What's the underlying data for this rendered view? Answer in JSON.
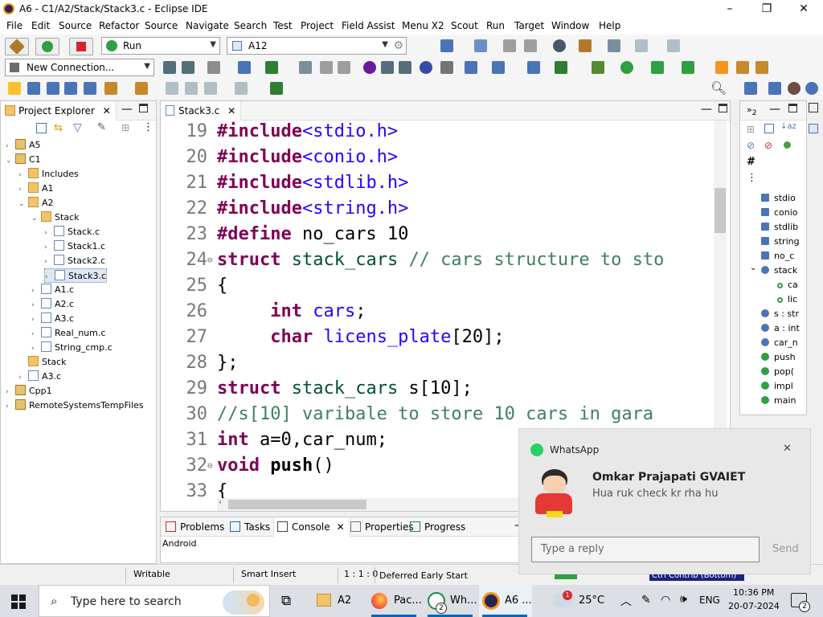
{
  "window": {
    "title": "A6 - C1/A2/Stack/Stack3.c - Eclipse IDE",
    "minimize": "–",
    "maximize": "❐",
    "close": "✕"
  },
  "menu": [
    "File",
    "Edit",
    "Source",
    "Refactor",
    "Source",
    "Navigate",
    "Search",
    "Test",
    "Project",
    "Field Assist",
    "Menu X2",
    "Scout",
    "Run",
    "Target",
    "Window",
    "Help"
  ],
  "toolbar": {
    "run_combo": "Run",
    "target_combo": "A12",
    "connection_combo": "New Connection..."
  },
  "project_explorer": {
    "tab_label": "Project Explorer",
    "items": [
      {
        "label": "A5",
        "kind": "proj",
        "depth": 0,
        "tw": "›"
      },
      {
        "label": "C1",
        "kind": "proj",
        "depth": 0,
        "tw": "⌄"
      },
      {
        "label": "Includes",
        "kind": "inc",
        "depth": 1,
        "tw": "›"
      },
      {
        "label": "A1",
        "kind": "folder",
        "depth": 1,
        "tw": "›"
      },
      {
        "label": "A2",
        "kind": "folder",
        "depth": 1,
        "tw": "⌄"
      },
      {
        "label": "Stack",
        "kind": "folder",
        "depth": 2,
        "tw": "⌄"
      },
      {
        "label": "Stack.c",
        "kind": "cfile",
        "depth": 3,
        "tw": "›"
      },
      {
        "label": "Stack1.c",
        "kind": "cfile",
        "depth": 3,
        "tw": "›"
      },
      {
        "label": "Stack2.c",
        "kind": "cfile",
        "depth": 3,
        "tw": "›"
      },
      {
        "label": "Stack3.c",
        "kind": "cfile",
        "depth": 3,
        "tw": "›",
        "selected": true
      },
      {
        "label": "A1.c",
        "kind": "cfile",
        "depth": 2,
        "tw": "›"
      },
      {
        "label": "A2.c",
        "kind": "cfile",
        "depth": 2,
        "tw": "›"
      },
      {
        "label": "A3.c",
        "kind": "cfile",
        "depth": 2,
        "tw": "›"
      },
      {
        "label": "Real_num.c",
        "kind": "cfile",
        "depth": 2,
        "tw": "›"
      },
      {
        "label": "String_cmp.c",
        "kind": "cfile",
        "depth": 2,
        "tw": "›"
      },
      {
        "label": "Stack",
        "kind": "folder",
        "depth": 1,
        "tw": ""
      },
      {
        "label": "A3.c",
        "kind": "cfile",
        "depth": 1,
        "tw": "›"
      },
      {
        "label": "Cpp1",
        "kind": "proj",
        "depth": 0,
        "tw": "›"
      },
      {
        "label": "RemoteSystemsTempFiles",
        "kind": "proj",
        "depth": 0,
        "tw": "›"
      }
    ]
  },
  "editor": {
    "tab_label": "Stack3.c",
    "lines": [
      {
        "n": "19",
        "html": [
          [
            "kw",
            "#include"
          ],
          [
            "str",
            "<stdio.h>"
          ]
        ]
      },
      {
        "n": "20",
        "html": [
          [
            "kw",
            "#include"
          ],
          [
            "str",
            "<conio.h>"
          ]
        ]
      },
      {
        "n": "21",
        "html": [
          [
            "kw",
            "#include"
          ],
          [
            "str",
            "<stdlib.h>"
          ]
        ]
      },
      {
        "n": "22",
        "html": [
          [
            "kw",
            "#include"
          ],
          [
            "str",
            "<string.h>"
          ]
        ]
      },
      {
        "n": "23",
        "html": [
          [
            "kw",
            "#define"
          ],
          [
            "",
            " no_cars 10"
          ]
        ]
      },
      {
        "n": "24",
        "fold": true,
        "html": [
          [
            "kw",
            "struct"
          ],
          [
            "",
            " "
          ],
          [
            "id",
            "stack_cars"
          ],
          [
            "",
            " "
          ],
          [
            "cm",
            "// cars structure to sto"
          ]
        ]
      },
      {
        "n": "25",
        "html": [
          [
            "",
            "{"
          ]
        ]
      },
      {
        "n": "26",
        "html": [
          [
            "",
            "     "
          ],
          [
            "kw",
            "int"
          ],
          [
            "",
            " "
          ],
          [
            "str",
            "cars"
          ],
          [
            "",
            ";"
          ]
        ]
      },
      {
        "n": "27",
        "html": [
          [
            "",
            "     "
          ],
          [
            "kw",
            "char"
          ],
          [
            "",
            " "
          ],
          [
            "str",
            "licens_plate"
          ],
          [
            "",
            "[20];"
          ]
        ]
      },
      {
        "n": "28",
        "html": [
          [
            "",
            "};"
          ]
        ]
      },
      {
        "n": "29",
        "html": [
          [
            "kw",
            "struct"
          ],
          [
            "",
            " "
          ],
          [
            "id",
            "stack_cars"
          ],
          [
            "",
            " s[10];"
          ]
        ]
      },
      {
        "n": "30",
        "html": [
          [
            "cm",
            "//s[10] varibale to store 10 cars in gara"
          ]
        ]
      },
      {
        "n": "31",
        "html": [
          [
            "kw",
            "int"
          ],
          [
            "",
            " a=0,car_num;"
          ]
        ]
      },
      {
        "n": "32",
        "fold": true,
        "html": [
          [
            "kw",
            "void"
          ],
          [
            "",
            " "
          ],
          [
            "b",
            "push"
          ],
          [
            "",
            "()"
          ]
        ]
      },
      {
        "n": "33",
        "html": [
          [
            "",
            "{"
          ]
        ]
      }
    ]
  },
  "outline": {
    "items": [
      "stdio",
      "conio",
      "stdlib",
      "string",
      "no_c",
      "stack",
      "ca",
      "lic",
      "s : str",
      "a : int",
      "car_n",
      "push",
      "pop(",
      "impl",
      "main"
    ]
  },
  "bottom_panel": {
    "tabs": [
      "Problems",
      "Tasks",
      "Console",
      "Properties",
      "Progress"
    ],
    "console_text": "Android"
  },
  "status": {
    "writable": "Writable",
    "insert": "Smart Insert",
    "position": "1 : 1 : 0",
    "early_start": "Deferred Early Start"
  },
  "notification": {
    "app": "WhatsApp",
    "sender": "Omkar Prajapati GVAIET",
    "message": "Hua ruk check kr rha hu",
    "reply_placeholder": "Type a reply",
    "send_label": "Send",
    "close": "✕"
  },
  "taskbar": {
    "search_placeholder": "Type here to search",
    "apps": [
      {
        "label": "A2"
      },
      {
        "label": "Pac..."
      },
      {
        "label": "Wh..."
      },
      {
        "label": "A6 ..."
      }
    ],
    "whatsapp_badge": "2",
    "weather": "25°C",
    "weather_badge": "1",
    "lang": "ENG",
    "time": "10:36 PM",
    "date": "20-07-2024",
    "notif_badge": "2",
    "ctn_label": "Ctrl Contrib (Bottom)"
  }
}
